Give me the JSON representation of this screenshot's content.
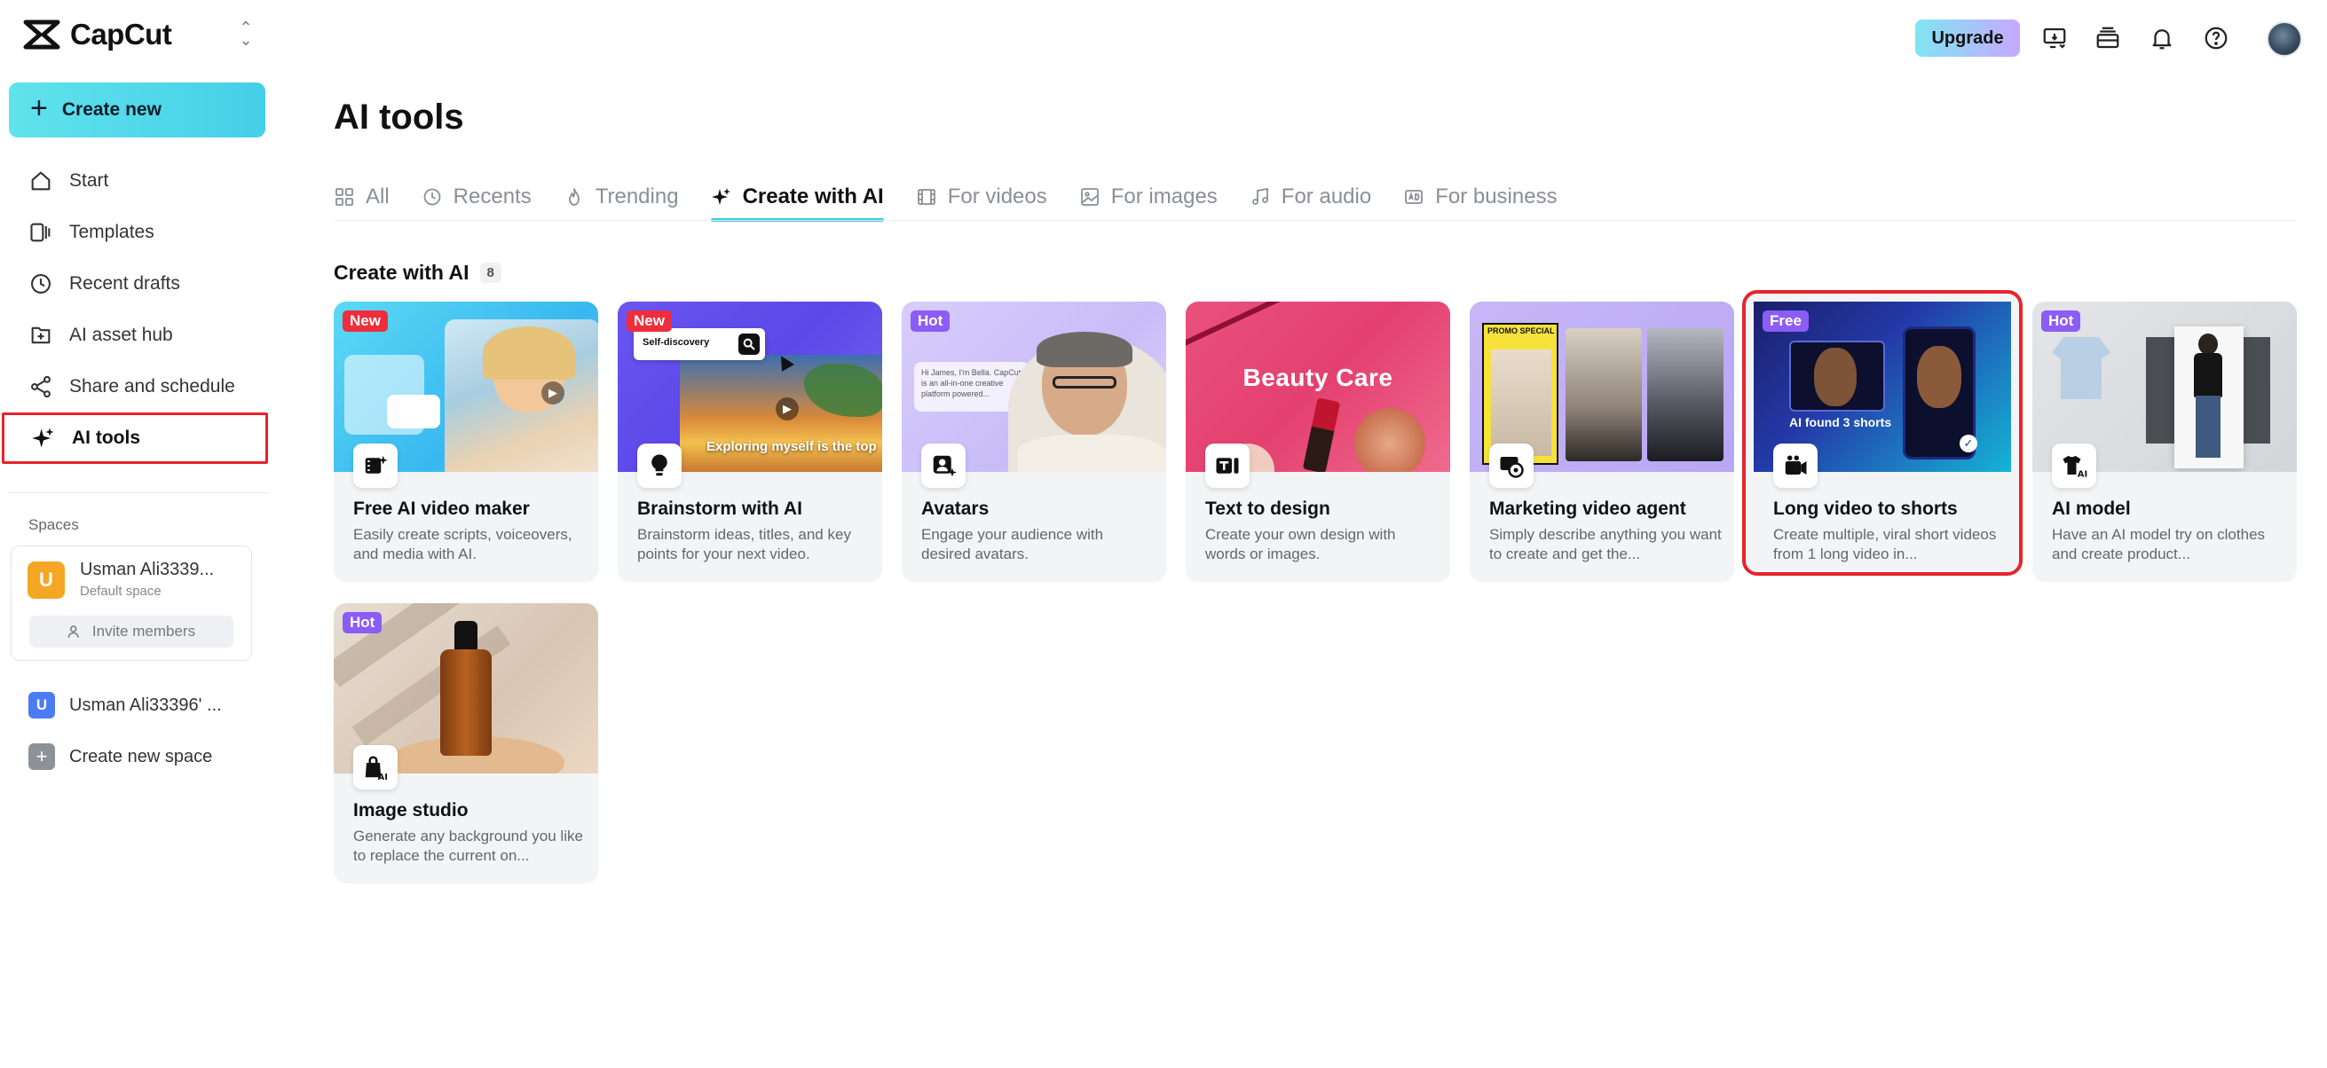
{
  "app": {
    "name": "CapCut",
    "create_new_label": "Create new"
  },
  "sidebar": {
    "items": [
      {
        "id": "start",
        "label": "Start",
        "icon": "home-icon"
      },
      {
        "id": "templates",
        "label": "Templates",
        "icon": "templates-icon"
      },
      {
        "id": "recent-drafts",
        "label": "Recent drafts",
        "icon": "clock-icon"
      },
      {
        "id": "ai-asset-hub",
        "label": "AI asset hub",
        "icon": "asset-hub-icon"
      },
      {
        "id": "share-schedule",
        "label": "Share and schedule",
        "icon": "share-icon"
      },
      {
        "id": "ai-tools",
        "label": "AI tools",
        "icon": "sparkle-icon",
        "active": true
      }
    ],
    "spaces_label": "Spaces",
    "space_card": {
      "avatar_letter": "U",
      "name": "Usman Ali3339...",
      "subtitle": "Default space",
      "invite_label": "Invite members"
    },
    "other_space": {
      "letter": "U",
      "name": "Usman Ali33396' ..."
    },
    "create_space_label": "Create new space"
  },
  "topbar": {
    "upgrade_label": "Upgrade"
  },
  "main": {
    "title": "AI tools",
    "tabs": [
      {
        "label": "All",
        "icon": "grid-icon"
      },
      {
        "label": "Recents",
        "icon": "clock-icon"
      },
      {
        "label": "Trending",
        "icon": "flame-icon"
      },
      {
        "label": "Create with AI",
        "icon": "sparkle-icon",
        "active": true
      },
      {
        "label": "For videos",
        "icon": "film-icon"
      },
      {
        "label": "For images",
        "icon": "image-icon"
      },
      {
        "label": "For audio",
        "icon": "music-icon"
      },
      {
        "label": "For business",
        "icon": "ad-icon"
      }
    ],
    "section_title": "Create with AI",
    "section_count": "8",
    "cards": [
      {
        "title": "Free AI video maker",
        "desc": "Easily create scripts, voiceovers, and media with AI.",
        "badge": "New",
        "badge_color": "#ef2d3b"
      },
      {
        "title": "Brainstorm with AI",
        "desc": "Brainstorm ideas, titles, and key points for your next video.",
        "badge": "New",
        "badge_color": "#ef2d3b",
        "thumb_search": "Self-discovery",
        "thumb_caption": "Exploring myself is the top"
      },
      {
        "title": "Avatars",
        "desc": "Engage your audience with desired avatars.",
        "badge": "Hot",
        "badge_color": "#8b5cf6",
        "thumb_text": "Hi James, I'm Bella. CapCut is an all-in-one creative platform powered..."
      },
      {
        "title": "Text to design",
        "desc": "Create your own design with words or images.",
        "thumb_text": "Beauty Care"
      },
      {
        "title": "Marketing video agent",
        "desc": "Simply describe anything you want to create and get the...",
        "thumb_text": "PROMO SPECIAL"
      },
      {
        "title": "Long video to shorts",
        "desc": "Create multiple, viral short videos from 1 long video in...",
        "badge": "Free",
        "badge_color": "#8b5cf6",
        "thumb_text": "AI found 3 shorts",
        "selected": true
      },
      {
        "title": "AI model",
        "desc": "Have an AI model try on clothes and create product...",
        "badge": "Hot",
        "badge_color": "#8b5cf6"
      },
      {
        "title": "Image studio",
        "desc": "Generate any background you like to replace the current on...",
        "badge": "Hot",
        "badge_color": "#8b5cf6"
      }
    ]
  },
  "colors": {
    "accent": "#3ec9df",
    "highlight": "#e8232b",
    "new_badge": "#ef2d3b",
    "hot_badge": "#8b5cf6"
  }
}
